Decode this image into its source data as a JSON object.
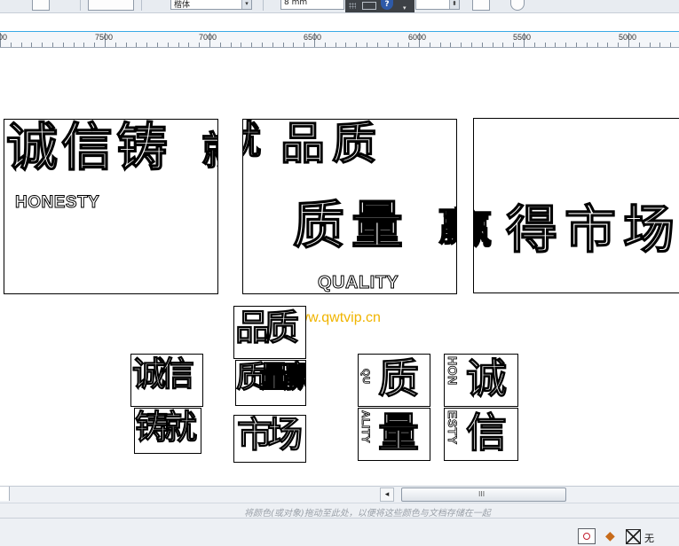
{
  "toolbar": {
    "font_combo_value": "楷体",
    "size_combo_value": "8 mm",
    "help_glyph": "?",
    "dropdown_glyph": "▾"
  },
  "ruler": {
    "labels": [
      "00",
      "7500",
      "7000",
      "6500",
      "6000",
      "5500",
      "5000"
    ]
  },
  "canvas": {
    "panel1": {
      "line1": "诚信铸",
      "cut": "就",
      "latin": "HONESTY"
    },
    "panel2": {
      "line1_cut": "就",
      "line1": "品质",
      "line2": "质量",
      "line2_small": "赢",
      "latin": "QUALITY"
    },
    "panel3": {
      "small": "赢",
      "line": "得市场"
    },
    "seals": {
      "s1": "诚信",
      "s2": "铸就",
      "s3": "品质",
      "s4": "质量赢",
      "s5": "市场",
      "s6": "质",
      "s7": "量",
      "s8": "诚",
      "s9": "信",
      "s6_latin": "QU",
      "s7_latin": "ALITY",
      "s8_latin": "HON",
      "s9_latin": "ESTY"
    },
    "watermark": "http://www.qwtvip.cn"
  },
  "scrollbar": {
    "left_arrow": "◂",
    "thumb_grip": "III"
  },
  "colorbar": {
    "hint": "将颜色(或对象)拖动至此处，以便将这些颜色与文档存储在一起"
  },
  "status": {
    "fill_label": "无"
  },
  "colors": {
    "guide": "#39a9e6",
    "watermark": "#f0b400",
    "help": "#2e5aa8"
  }
}
